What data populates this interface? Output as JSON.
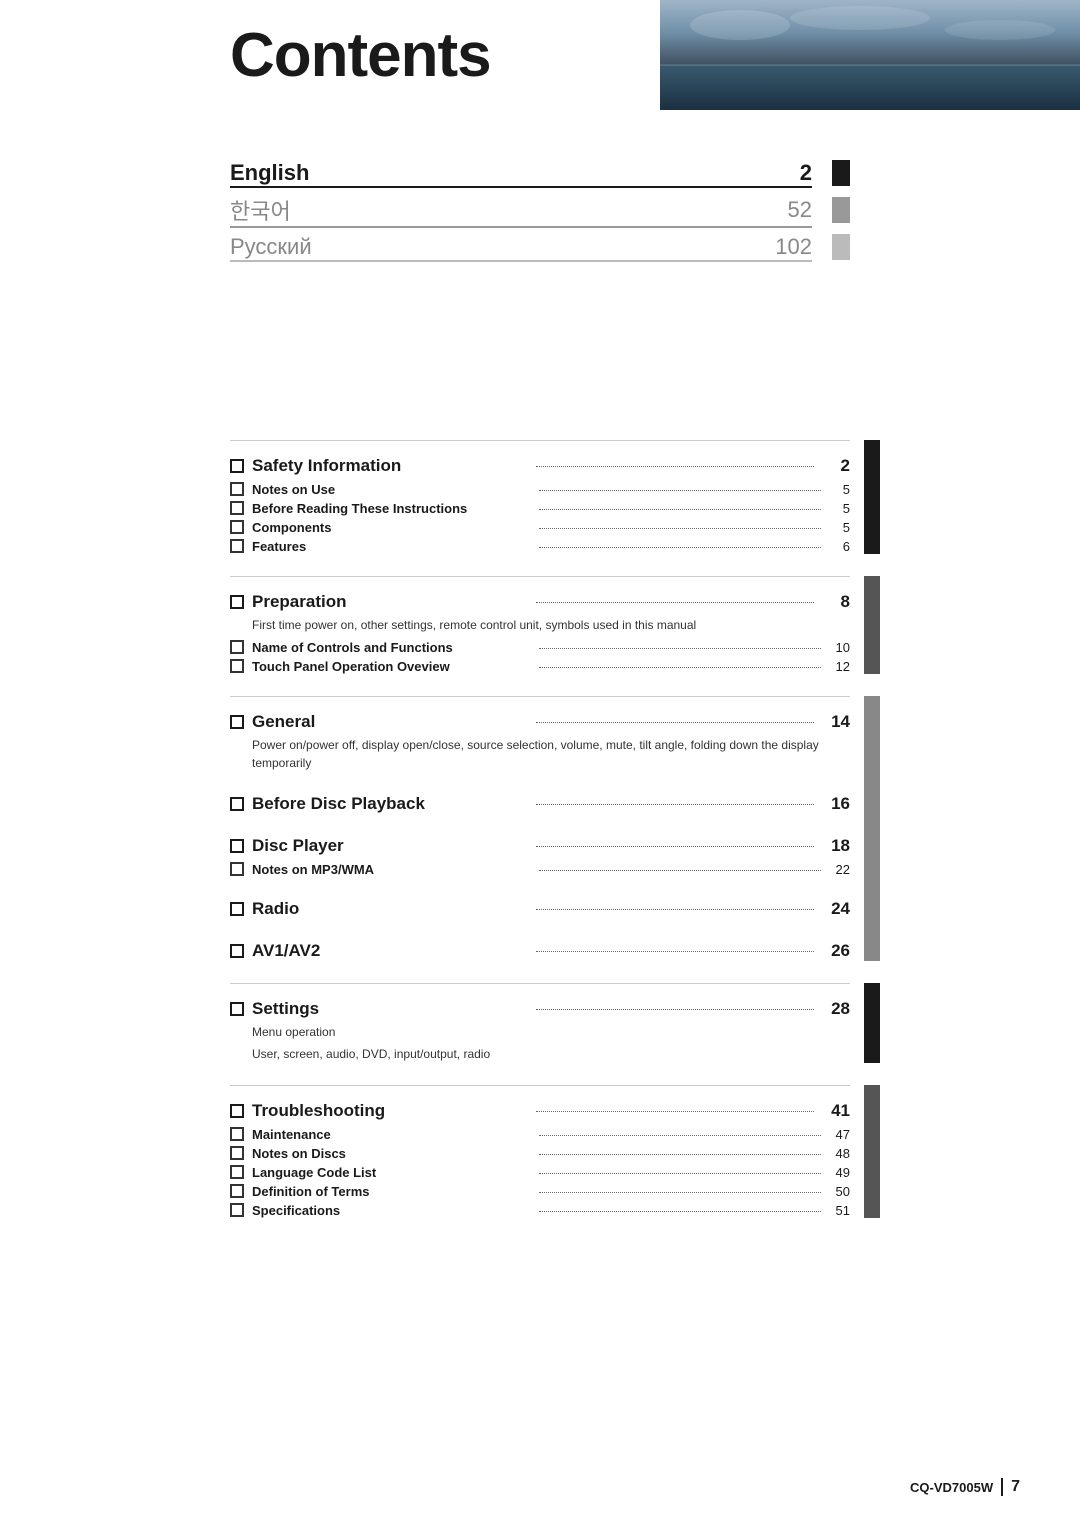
{
  "header": {
    "title": "Contents"
  },
  "languages": [
    {
      "name": "English",
      "page": "2",
      "style": "bold",
      "bar": "black"
    },
    {
      "name": "한국어",
      "page": "52",
      "style": "light",
      "bar": "gray"
    },
    {
      "name": "Русский",
      "page": "102",
      "style": "light",
      "bar": "light-gray"
    }
  ],
  "sections": [
    {
      "id": "safety",
      "title": "Safety Information",
      "dots": true,
      "page": "2",
      "description": "",
      "subsections": [
        {
          "title": "Notes on Use",
          "dots": true,
          "page": "5"
        },
        {
          "title": "Before Reading These Instructions",
          "dots": true,
          "page": "5"
        },
        {
          "title": "Components",
          "dots": true,
          "page": "5"
        },
        {
          "title": "Features",
          "dots": true,
          "page": "6"
        }
      ]
    },
    {
      "id": "preparation",
      "title": "Preparation",
      "dots": true,
      "page": "8",
      "description": "First time power on, other settings, remote control unit, symbols used in this manual",
      "subsections": [
        {
          "title": "Name of Controls and Functions",
          "dots": true,
          "page": "10"
        },
        {
          "title": "Touch Panel Operation Oveview",
          "dots": true,
          "page": "12"
        }
      ]
    },
    {
      "id": "general",
      "title": "General",
      "dots": true,
      "page": "14",
      "description": "Power on/power off, display open/close, source selection, volume, mute, tilt angle, folding down the display temporarily",
      "subsections": []
    },
    {
      "id": "before-disc",
      "title": "Before Disc Playback",
      "dots": true,
      "page": "16",
      "description": "",
      "subsections": []
    },
    {
      "id": "disc-player",
      "title": "Disc Player",
      "dots": true,
      "page": "18",
      "description": "",
      "subsections": [
        {
          "title": "Notes on MP3/WMA",
          "dots": true,
          "page": "22"
        }
      ]
    },
    {
      "id": "radio",
      "title": "Radio",
      "dots": true,
      "page": "24",
      "description": "",
      "subsections": []
    },
    {
      "id": "av",
      "title": "AV1/AV2",
      "dots": true,
      "page": "26",
      "description": "",
      "subsections": []
    },
    {
      "id": "settings",
      "title": "Settings",
      "dots": true,
      "page": "28",
      "description": "Menu operation\nUser, screen, audio, DVD, input/output, radio",
      "subsections": []
    },
    {
      "id": "troubleshooting",
      "title": "Troubleshooting",
      "dots": true,
      "page": "41",
      "description": "",
      "subsections": [
        {
          "title": "Maintenance",
          "dots": true,
          "page": "47"
        },
        {
          "title": "Notes on Discs",
          "dots": true,
          "page": "48"
        },
        {
          "title": "Language Code List",
          "dots": true,
          "page": "49"
        },
        {
          "title": "Definition of Terms",
          "dots": true,
          "page": "50"
        },
        {
          "title": "Specifications",
          "dots": true,
          "page": "51"
        }
      ]
    }
  ],
  "footer": {
    "model": "CQ-VD7005W",
    "page": "7"
  }
}
